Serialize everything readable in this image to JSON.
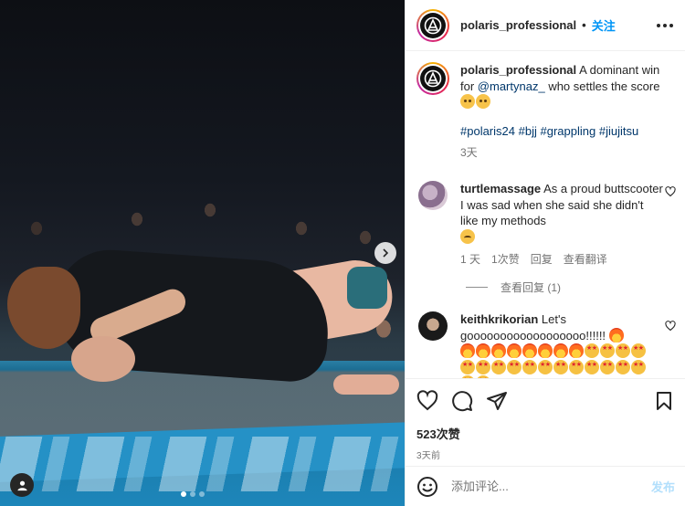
{
  "header": {
    "username": "polaris_professional",
    "separator": "•",
    "follow_label": "关注"
  },
  "caption": {
    "username": "polaris_professional",
    "text_before": "A dominant win for",
    "mention": "@martynaz_",
    "text_after": "who settles the score",
    "hashtags": [
      "#polaris24",
      "#bjj",
      "#grappling",
      "#jiujitsu"
    ],
    "time": "3天"
  },
  "comments": [
    {
      "username": "turtlemassage",
      "text": "As a proud buttscooter I was sad when she said she didn't like my methods",
      "time": "1 天",
      "likes": "1次赞",
      "reply": "回复",
      "translate": "查看翻译",
      "view_replies": "查看回复 (1)"
    },
    {
      "username": "keithkrikorian",
      "text": "Let's goooooooooooooooooo!!!!!!"
    }
  ],
  "actions": {
    "likes": "523次赞",
    "time_ago": "3天前"
  },
  "add_comment": {
    "placeholder": "添加评论...",
    "post_label": "发布"
  },
  "icons": {
    "like": "heart-icon",
    "comment": "comment-icon",
    "share": "share-icon",
    "save": "bookmark-icon",
    "emoji": "emoji-icon",
    "more": "more-icon",
    "next": "chevron-right-icon",
    "tags": "user-tag-icon"
  },
  "colors": {
    "accent": "#0095f6",
    "link": "#00376b",
    "muted": "#737373",
    "post_disabled": "#b2dffc"
  },
  "carousel": {
    "slides": 3,
    "active_index": 0
  }
}
